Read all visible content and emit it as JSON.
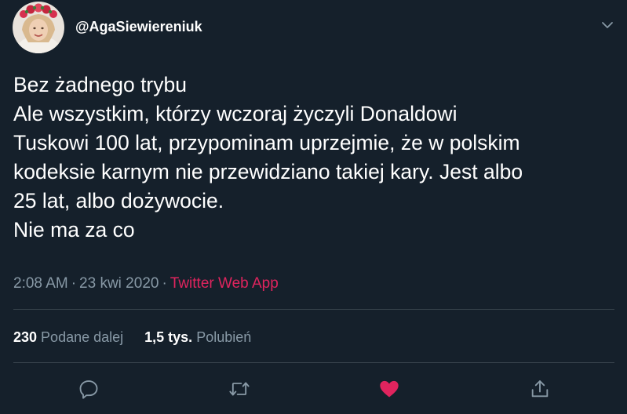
{
  "tweet": {
    "handle": "@AgaSiewiereniuk",
    "text_lines": [
      "Bez żadnego trybu",
      "Ale wszystkim, którzy wczoraj życzyli Donaldowi",
      "Tuskowi 100 lat, przypominam uprzejmie, że w polskim",
      "kodeksie karnym nie przewidziano takiej kary. Jest albo",
      "25 lat, albo dożywocie.",
      "Nie ma za co"
    ],
    "time": "2:08 AM",
    "separator": "·",
    "date": "23 kwi 2020",
    "source": "Twitter Web App"
  },
  "stats": {
    "retweets_count": "230",
    "retweets_label": "Podane dalej",
    "likes_count": "1,5 tys.",
    "likes_label": "Polubień"
  },
  "actions": {
    "reply_icon": "reply-icon",
    "retweet_icon": "retweet-icon",
    "like_icon": "heart-icon",
    "share_icon": "share-icon",
    "liked": true
  },
  "colors": {
    "background": "#15202b",
    "text": "#ffffff",
    "secondary_text": "#8899a6",
    "divider": "#38444d",
    "accent_pink": "#e0245e",
    "icon_gray": "#8899a6"
  }
}
